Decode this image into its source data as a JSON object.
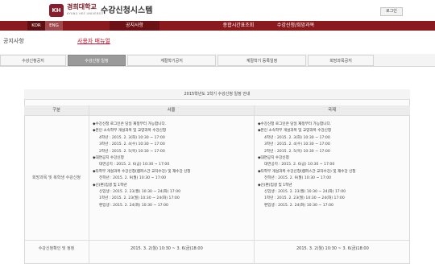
{
  "header": {
    "logo_emblem": "KH",
    "university": "경희대학교",
    "university_en": "KYUNG HEE UNIVERSITY",
    "system_title": "수강신청시스템",
    "login_label": "로그인"
  },
  "nav": {
    "lang_kor": "KOR",
    "lang_eng": "ENG",
    "notice": "공지사항",
    "timetable": "종합시간표조회",
    "register": "수강신청/희망과목"
  },
  "subheader": {
    "title": "공지사항",
    "manual": "사용자 매뉴얼"
  },
  "tabs": [
    {
      "label": "수강신청공지"
    },
    {
      "label": "수강신청 일정"
    },
    {
      "label": "계절학기공지"
    },
    {
      "label": "계절학기 등록일정"
    },
    {
      "label": "희망과목공지"
    }
  ],
  "table": {
    "caption": "2015학년도 1학기 수강신청 일정 안내",
    "columns": [
      "구분",
      "서울",
      "국제"
    ],
    "row1_label": "희망과목 및 복학생 수강신청",
    "seoul": [
      {
        "text": "◆수강신청 로그인은 당일 재정부터 가능합니다.",
        "type": "head"
      },
      {
        "text": "◆본인 소속학부 개설과목 및 교양과목 수강신청",
        "type": "head"
      },
      {
        "text": "4학년 : 2015. 2. 3(화) 10:30 ~ 17:00",
        "type": "ind"
      },
      {
        "text": "3학년 : 2015. 2. 4(수) 10:30 ~ 17:00",
        "type": "ind"
      },
      {
        "text": "2학년 : 2015. 2. 5(목) 10:30 ~ 17:00",
        "type": "ind"
      },
      {
        "text": "◆대면공지 수강신청",
        "type": "head"
      },
      {
        "text": "대면공지 : 2015. 2. 6(금) 10:30 ~ 17:00",
        "type": "ind"
      },
      {
        "text": "◆타학부 개설과목 수강신청(캠퍼스간 교차수강) 및 재수강 신청",
        "type": "head"
      },
      {
        "text": "전학년 : 2015. 2. 9(월) 10:30 ~ 17:00",
        "type": "ind"
      },
      {
        "text": "◆신(편)입생 및 1학년",
        "type": "head"
      },
      {
        "text": "신입생 : 2015. 2. 23(월) 10:30 ~ 24(화) 17:00",
        "type": "ind"
      },
      {
        "text": "1학년 : 2015. 2. 23(월) 10:30 ~ 24(화) 17:00",
        "type": "ind"
      },
      {
        "text": "편입생 : 2015. 2. 24(화) 10:30 ~ 17:00",
        "type": "ind"
      }
    ],
    "global": [
      {
        "text": "◆수강신청 로그인은 당일 재정부터 가능합니다.",
        "type": "head"
      },
      {
        "text": "◆본인 소속학부 개설과목 및 교양과목 수강신청",
        "type": "head"
      },
      {
        "text": "4학년 : 2015. 2. 3(화) 10:30 ~ 17:00",
        "type": "ind"
      },
      {
        "text": "3학년 : 2015. 2. 4(수) 10:30 ~ 17:00",
        "type": "ind"
      },
      {
        "text": "2학년 : 2015. 2. 5(목) 10:30 ~ 17:00",
        "type": "ind"
      },
      {
        "text": "◆대면공지 수강신청",
        "type": "head"
      },
      {
        "text": "대면공지 : 2015. 2. 6(금) 10:30 ~ 17:00",
        "type": "ind"
      },
      {
        "text": "◆타학부 개설과목 수강신청(캠퍼스간 교차수강) 및 재수강 신청",
        "type": "head"
      },
      {
        "text": "전학년 : 2015. 2. 9(월) 10:30 ~ 17:00",
        "type": "ind"
      },
      {
        "text": "◆신(편)입생 및 1학년",
        "type": "head"
      },
      {
        "text": "신입생 : 2015. 2. 23(월) 10:30 ~ 24(화) 17:00",
        "type": "ind"
      },
      {
        "text": "1학년 : 2015. 2. 23(월) 10:30 ~ 24(화) 17:00",
        "type": "ind"
      },
      {
        "text": "편입생 : 2015. 2. 24(화) 10:30 ~ 17:00",
        "type": "ind"
      }
    ],
    "row2_label": "수강신청확인 및 정정",
    "row2_seoul": "2015. 3. 2(월) 10:30 ~ 3. 6(금)18:00",
    "row2_global": "2015. 3. 2(월) 10:30 ~ 3. 6(금)18:00"
  }
}
